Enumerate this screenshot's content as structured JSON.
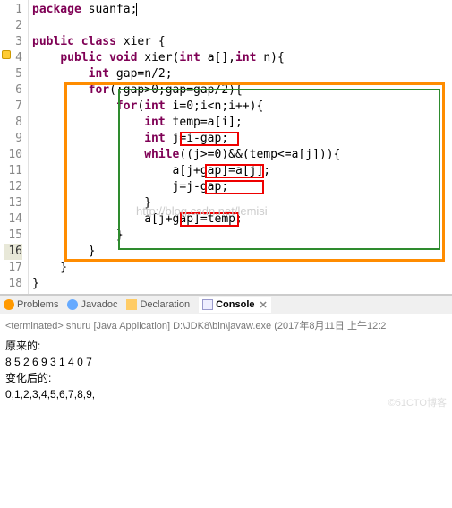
{
  "gutter": [
    "1",
    "2",
    "3",
    "4",
    "5",
    "6",
    "7",
    "8",
    "9",
    "10",
    "11",
    "12",
    "13",
    "14",
    "15",
    "16",
    "17",
    "18"
  ],
  "currentLine": 16,
  "code": {
    "l1a": "package",
    "l1b": " suanfa;",
    "l3a": "public",
    "l3b": " ",
    "l3c": "class",
    "l3d": " xier {",
    "l4a": "    ",
    "l4b": "public",
    "l4c": " ",
    "l4d": "void",
    "l4e": " xier(",
    "l4f": "int",
    "l4g": " a[],",
    "l4h": "int",
    "l4i": " n){",
    "l5a": "        ",
    "l5b": "int",
    "l5c": " gap=n/2;",
    "l6a": "        ",
    "l6b": "for",
    "l6c": "(;gap>0;gap=gap/2){",
    "l7a": "            ",
    "l7b": "for",
    "l7c": "(",
    "l7d": "int",
    "l7e": " i=0;i<n;i++){",
    "l8a": "                ",
    "l8b": "int",
    "l8c": " temp=a[i];",
    "l9a": "                ",
    "l9b": "int",
    "l9c": " ",
    "l9d": "j=i-gap;",
    "l10a": "                ",
    "l10b": "while",
    "l10c": "((j>=0)&&(temp<=a[j])){",
    "l11a": "                    ",
    "l11b": "a[j+gap]",
    "l11c": "=a[j];",
    "l12a": "                    ",
    "l12b": "j=j-gap;",
    "l13": "                }",
    "l14a": "                ",
    "l14b": "a[j+gap]",
    "l14c": "=temp;",
    "l15": "            }",
    "l16": "        }",
    "l17": "    }",
    "l18": "}"
  },
  "watermark": "http://blog.csdn.net/lemisi",
  "tabs": {
    "problems": "Problems",
    "javadoc": "Javadoc",
    "declaration": "Declaration",
    "console": "Console"
  },
  "console": {
    "header": "<terminated> shuru [Java Application] D:\\JDK8\\bin\\javaw.exe (2017年8月11日 上午12:2",
    "line1": "原来的:",
    "line2": "8 5 2 6 9 3 1 4 0 7",
    "line3": "变化后的:",
    "line4": "0,1,2,3,4,5,6,7,8,9,"
  },
  "blogMark": "©51CTO博客"
}
